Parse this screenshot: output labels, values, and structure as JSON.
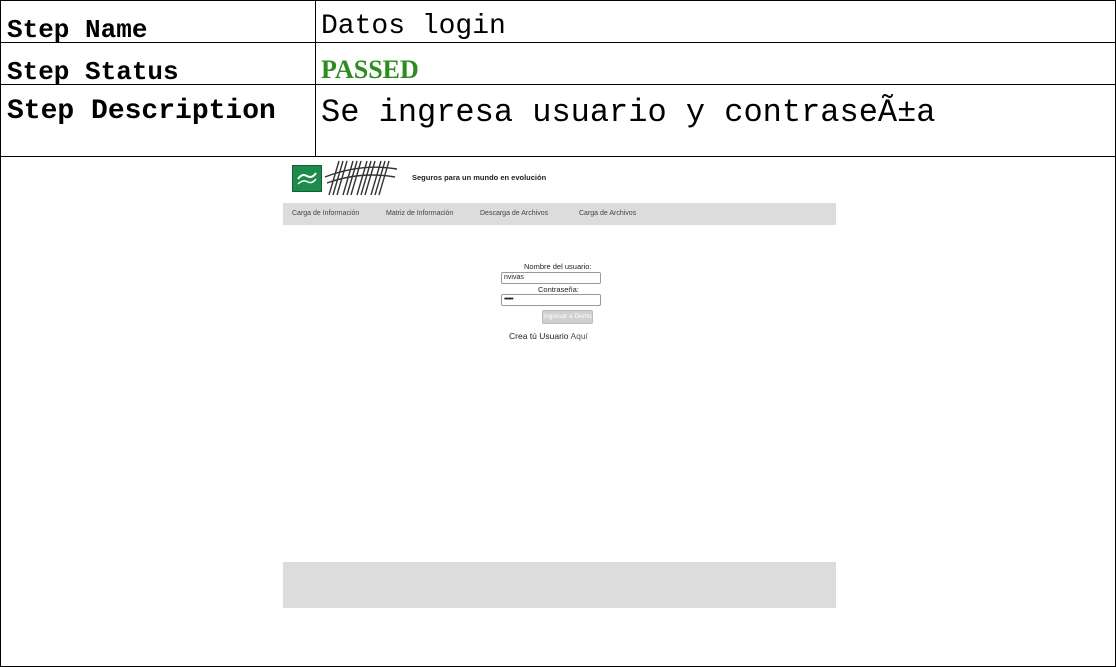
{
  "report": {
    "rows": [
      {
        "label": "Step Name",
        "value": "Datos login"
      },
      {
        "label": "Step Status",
        "value": "PASSED"
      },
      {
        "label": "Step Description",
        "value": "Se ingresa usuario y contraseÃ±a"
      }
    ],
    "status_color": "#2e8b22"
  },
  "app": {
    "tagline": "Seguros para un mundo en evolución",
    "nav": [
      {
        "label": "Carga de Información"
      },
      {
        "label": "Matriz de Información"
      },
      {
        "label": "Descarga de Archivos"
      },
      {
        "label": "Carga de Archivos"
      }
    ],
    "login": {
      "user_label": "Nombre del usuario:",
      "user_value": "nvivas",
      "password_label": "Contraseña:",
      "password_value": "••••••",
      "submit_label": "Ingresar a Demo",
      "signup_text": "Crea tú Usuario",
      "signup_link": "Aquí"
    },
    "colors": {
      "nav_bg": "#dcdcdc",
      "logo_green": "#1d8b4c",
      "button_bg": "#d0d0d0"
    },
    "icons": {
      "logo": "insurer-logo-icon",
      "brand": "brand-wordmark-icon"
    }
  }
}
